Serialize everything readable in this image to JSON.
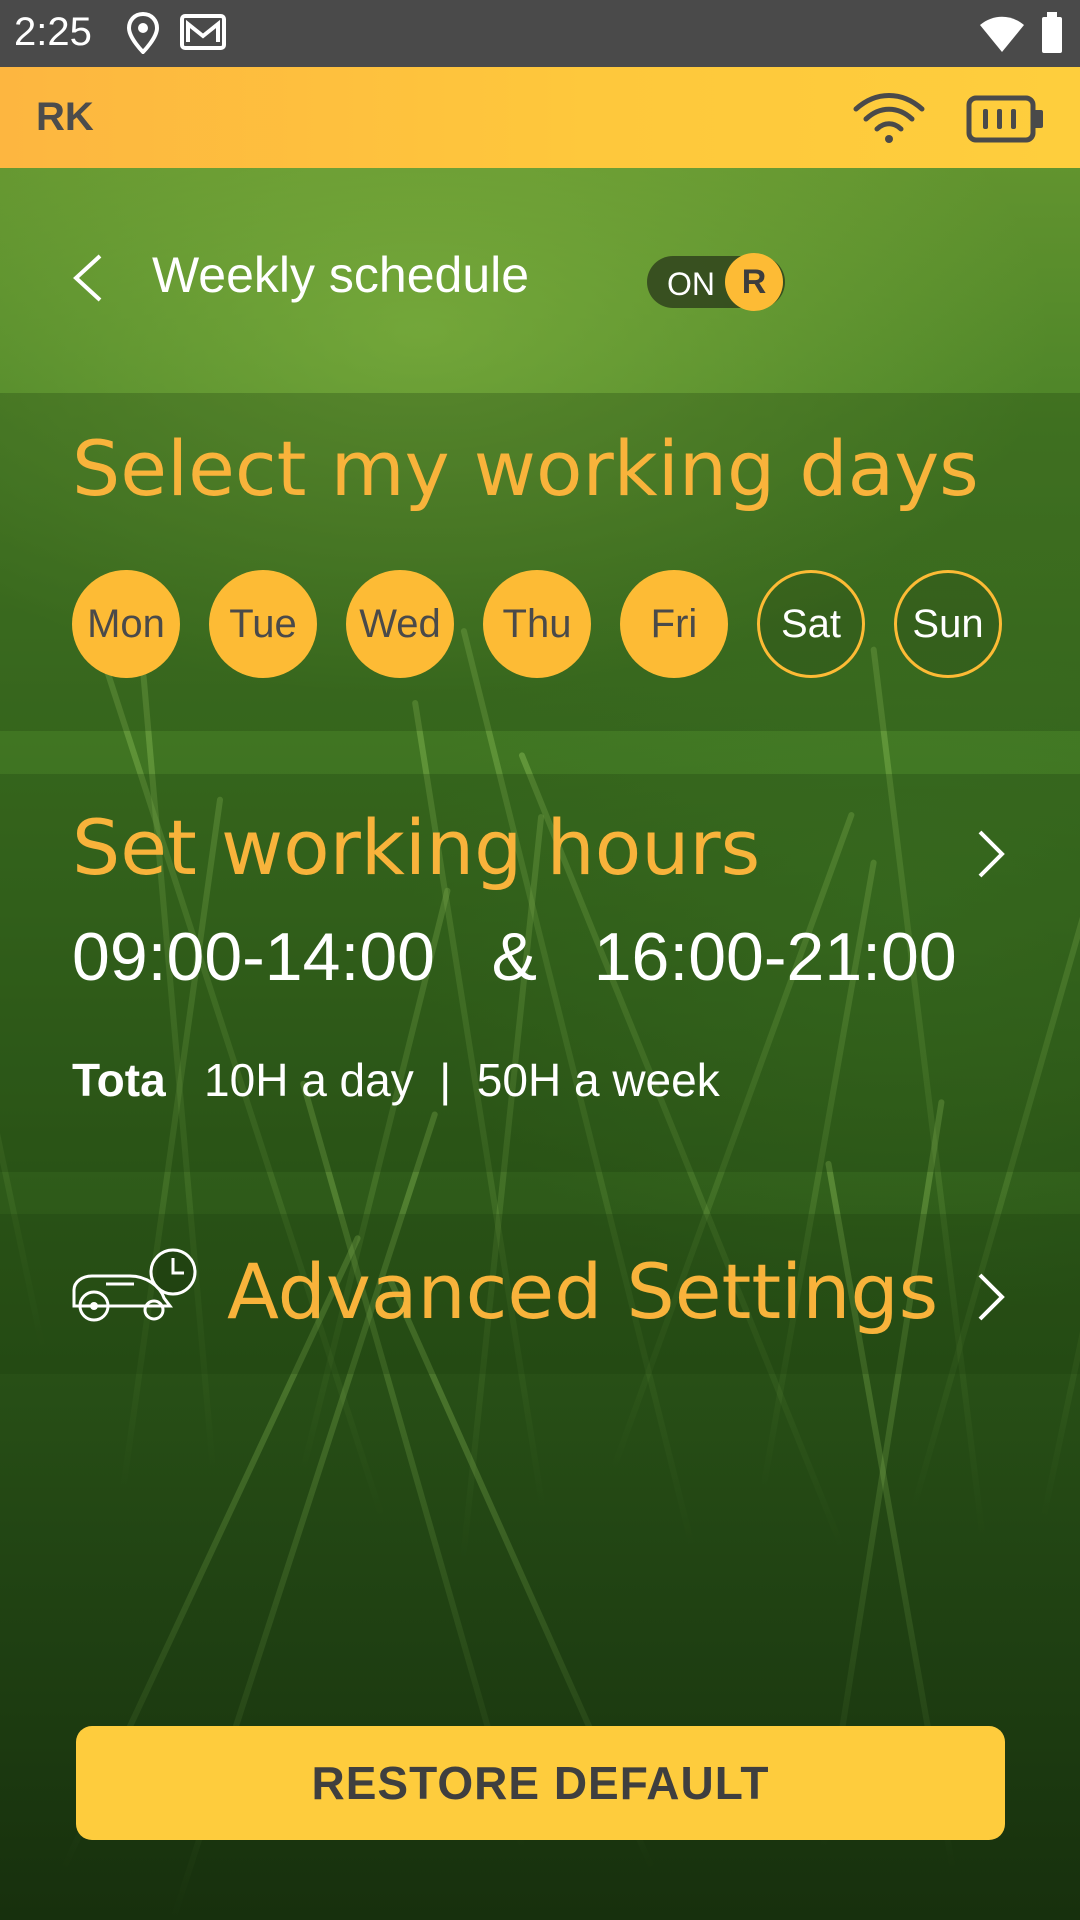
{
  "status_bar": {
    "time": "2:25",
    "icons": [
      "location-icon",
      "gmail-icon",
      "wifi-icon",
      "battery-icon"
    ]
  },
  "header": {
    "brand": "RK",
    "icons": [
      "wifi-icon",
      "battery-icon"
    ],
    "color": "#fec83c"
  },
  "title_bar": {
    "title": "Weekly schedule",
    "toggle_label": "ON",
    "toggle_knob": "R"
  },
  "working_days": {
    "title": "Select my working days",
    "days": [
      {
        "label": "Mon",
        "selected": true
      },
      {
        "label": "Tue",
        "selected": true
      },
      {
        "label": "Wed",
        "selected": true
      },
      {
        "label": "Thu",
        "selected": true
      },
      {
        "label": "Fri",
        "selected": true
      },
      {
        "label": "Sat",
        "selected": false
      },
      {
        "label": "Sun",
        "selected": false
      }
    ]
  },
  "working_hours": {
    "title": "Set working hours",
    "ranges": "09:00-14:00   &   16:00-21:00",
    "total_label": "Tota",
    "total_value": "   10H a day  |  50H a week"
  },
  "advanced": {
    "title": "Advanced Settings"
  },
  "restore_button": {
    "label": "RESTORE DEFAULT"
  },
  "colors": {
    "accent": "#f8b33b",
    "button": "#fecc3d",
    "status_bar": "#4a4a4a"
  }
}
